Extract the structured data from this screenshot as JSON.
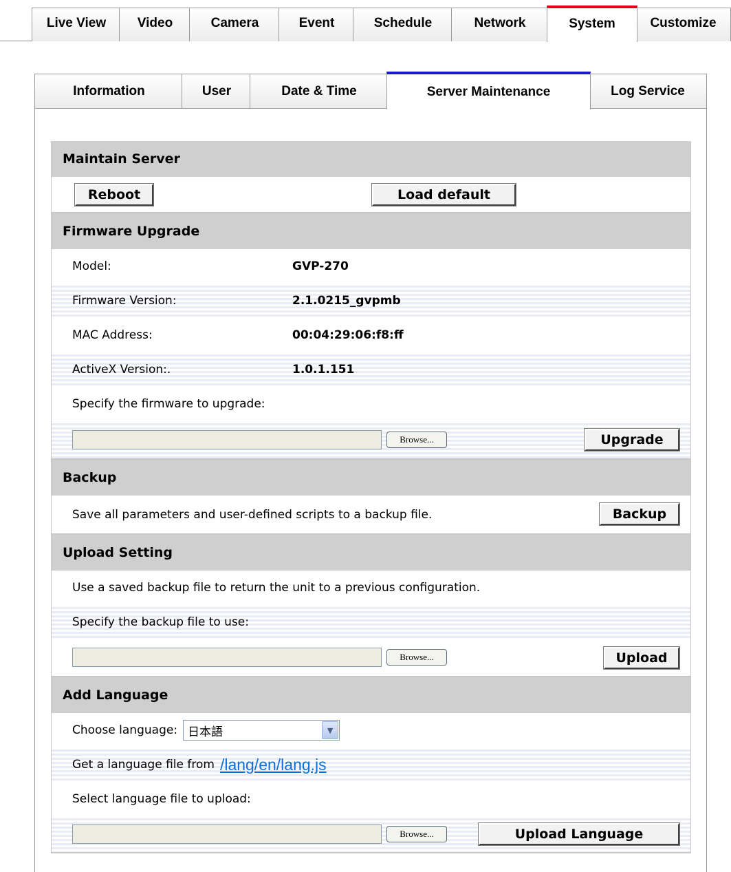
{
  "top_tabs": [
    {
      "label": "Live View"
    },
    {
      "label": "Video"
    },
    {
      "label": "Camera"
    },
    {
      "label": "Event"
    },
    {
      "label": "Schedule"
    },
    {
      "label": "Network"
    },
    {
      "label": "System",
      "active": true
    },
    {
      "label": "Customize"
    }
  ],
  "sub_tabs": [
    {
      "label": "Information"
    },
    {
      "label": "User"
    },
    {
      "label": "Date & Time"
    },
    {
      "label": "Server Maintenance",
      "active": true
    },
    {
      "label": "Log Service"
    }
  ],
  "maintain_server": {
    "title": "Maintain Server",
    "reboot_label": "Reboot",
    "load_default_label": "Load default"
  },
  "firmware_upgrade": {
    "title": "Firmware Upgrade",
    "fields": [
      {
        "label": "Model:",
        "value": "GVP-270"
      },
      {
        "label": "Firmware Version:",
        "value": "2.1.0215_gvpmb"
      },
      {
        "label": "MAC Address:",
        "value": "00:04:29:06:f8:ff"
      },
      {
        "label": "ActiveX Version:.",
        "value": "1.0.1.151"
      }
    ],
    "specify_text": "Specify the firmware to upgrade:",
    "file_value": "",
    "browse_label": "Browse...",
    "upgrade_label": "Upgrade"
  },
  "backup": {
    "title": "Backup",
    "description": "Save all parameters and user-defined scripts to a backup file.",
    "backup_label": "Backup"
  },
  "upload_setting": {
    "title": "Upload Setting",
    "description": "Use a saved backup file to return the unit to a previous configuration.",
    "specify_text": "Specify the backup file to use:",
    "file_value": "",
    "browse_label": "Browse...",
    "upload_label": "Upload"
  },
  "add_language": {
    "title": "Add Language",
    "choose_label": "Choose language:",
    "selected_language": "日本語",
    "get_file_text": "Get a language file from",
    "link_text": "/lang/en/lang.js",
    "select_file_text": "Select language file to upload:",
    "file_value": "",
    "browse_label": "Browse...",
    "upload_language_label": "Upload Language"
  },
  "colors": {
    "system_tab_accent": "#e0001a",
    "sub_tab_accent": "#1a1acc",
    "section_header_bg": "#cfcfcf",
    "link": "#0b6fd6"
  }
}
